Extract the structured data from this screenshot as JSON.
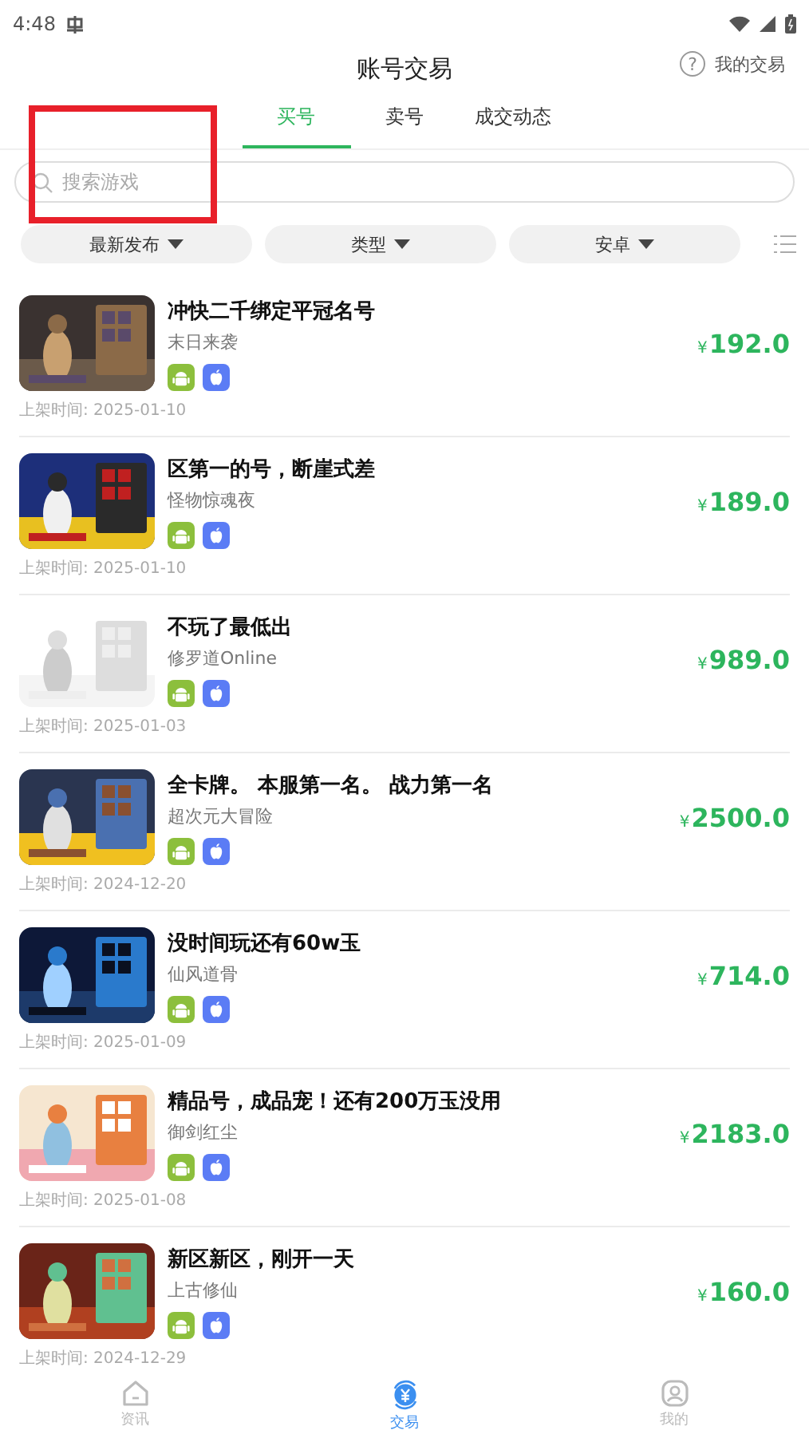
{
  "status_bar": {
    "time": "4:48"
  },
  "header": {
    "title": "账号交易",
    "help_icon": "?",
    "my_trades": "我的交易"
  },
  "tabs": [
    {
      "label": "买号",
      "selected": true
    },
    {
      "label": "卖号",
      "selected": false
    },
    {
      "label": "成交动态",
      "selected": false
    }
  ],
  "search": {
    "placeholder": "搜索游戏"
  },
  "filters": [
    {
      "label": "最新发布"
    },
    {
      "label": "类型"
    },
    {
      "label": "安卓"
    }
  ],
  "listings": [
    {
      "title": "冲快二千绑定平冠名号",
      "game": "末日来袭",
      "platforms": [
        {
          "kind": "android"
        },
        {
          "kind": "ios"
        }
      ],
      "currency": "¥",
      "price": "192.0",
      "listed": "上架时间: 2025-01-10"
    },
    {
      "title": "区第一的号，断崖式差",
      "game": "怪物惊魂夜",
      "platforms": [
        {
          "kind": "android"
        },
        {
          "kind": "ios"
        }
      ],
      "currency": "¥",
      "price": "189.0",
      "listed": "上架时间: 2025-01-10"
    },
    {
      "title": "不玩了最低出",
      "game": "修罗道Online",
      "platforms": [
        {
          "kind": "android"
        },
        {
          "kind": "ios"
        }
      ],
      "currency": "¥",
      "price": "989.0",
      "listed": "上架时间: 2025-01-03"
    },
    {
      "title": "全卡牌。 本服第一名。 战力第一名",
      "game": "超次元大冒险",
      "platforms": [
        {
          "kind": "android"
        },
        {
          "kind": "ios"
        }
      ],
      "currency": "¥",
      "price": "2500.0",
      "listed": "上架时间: 2024-12-20"
    },
    {
      "title": "没时间玩还有60w玉",
      "game": "仙风道骨",
      "platforms": [
        {
          "kind": "android"
        },
        {
          "kind": "ios"
        }
      ],
      "currency": "¥",
      "price": "714.0",
      "listed": "上架时间: 2025-01-09"
    },
    {
      "title": "精品号，成品宠！还有200万玉没用",
      "game": "御剑红尘",
      "platforms": [
        {
          "kind": "android"
        },
        {
          "kind": "ios"
        }
      ],
      "currency": "¥",
      "price": "2183.0",
      "listed": "上架时间: 2025-01-08"
    },
    {
      "title": "新区新区，刚开一天",
      "game": "上古修仙",
      "platforms": [
        {
          "kind": "android"
        },
        {
          "kind": "ios"
        }
      ],
      "currency": "¥",
      "price": "160.0",
      "listed": "上架时间: 2024-12-29"
    }
  ],
  "bottom_nav": [
    {
      "label": "资讯",
      "kind": "home",
      "selected": false
    },
    {
      "label": "交易",
      "kind": "trade",
      "selected": true
    },
    {
      "label": "我的",
      "kind": "profile",
      "selected": false
    }
  ]
}
